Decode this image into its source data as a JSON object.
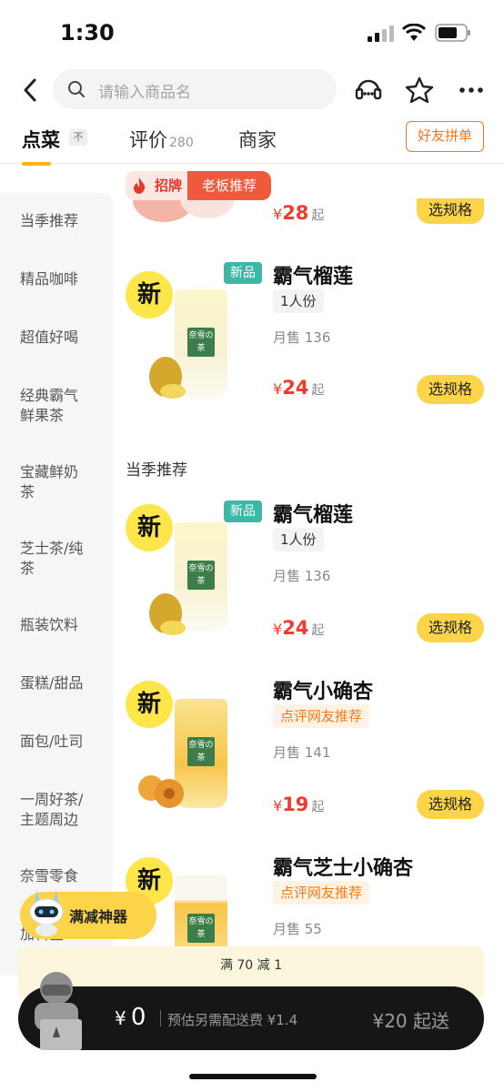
{
  "status_bar": {
    "time": "1:30"
  },
  "header": {
    "search_placeholder": "请输入商品名",
    "icons": [
      "back-icon",
      "search-icon",
      "customer-service-icon",
      "star-icon",
      "more-icon"
    ]
  },
  "tabs": {
    "order": "点菜",
    "order_tag": "不",
    "reviews": "评价",
    "reviews_count": "280",
    "merchant": "商家",
    "group_buy": "好友拼单"
  },
  "sidebar": {
    "items": [
      "当季推荐",
      "精品咖啡",
      "超值好喝",
      "经典霸气鲜果茶",
      "宝藏鲜奶茶",
      "芝士茶/纯茶",
      "瓶装饮料",
      "蛋糕/甜品",
      "面包/吐司",
      "一周好茶/主题周边",
      "奈雪零食",
      "加料区"
    ]
  },
  "top_partial": {
    "badge_left": "招牌",
    "badge_right": "老板推荐",
    "price_yen": "¥",
    "price": "28",
    "price_suffix": "起",
    "spec_button": "选规格"
  },
  "products_above": [
    {
      "new_badge": "新品",
      "name": "霸气榴莲",
      "tag": "1人份",
      "sales": "月售 136",
      "price_yen": "¥",
      "price": "24",
      "price_suffix": "起",
      "spec_button": "选规格",
      "image_new_mark": "新"
    }
  ],
  "section": {
    "title": "当季推荐",
    "products": [
      {
        "new_badge": "新品",
        "name": "霸气榴莲",
        "tag": "1人份",
        "sales": "月售 136",
        "price_yen": "¥",
        "price": "24",
        "price_suffix": "起",
        "spec_button": "选规格",
        "image_new_mark": "新"
      },
      {
        "name": "霸气小确杏",
        "tag": "点评网友推荐",
        "sales": "月售 141",
        "price_yen": "¥",
        "price": "19",
        "price_suffix": "起",
        "spec_button": "选规格",
        "image_new_mark": "新"
      },
      {
        "name": "霸气芝士小确杏",
        "tag": "点评网友推荐",
        "sales": "月售 55",
        "image_new_mark": "新"
      }
    ]
  },
  "cup_label": "奈雪の茶",
  "cup_brand": "NAYUKI",
  "promo_chip": {
    "label": "满减神器"
  },
  "discount_bar": {
    "text": "满 70 减 1"
  },
  "cart": {
    "currency": "¥",
    "amount": "0",
    "delivery_fee": "预估另需配送费 ¥1.4",
    "min_order": "¥20 起送"
  },
  "colors": {
    "accent_yellow": "#fbd44a",
    "price_red": "#f23b2c",
    "tag_orange": "#f27a1a",
    "new_badge_teal": "#3fb7a6",
    "cart_black": "#161616"
  }
}
